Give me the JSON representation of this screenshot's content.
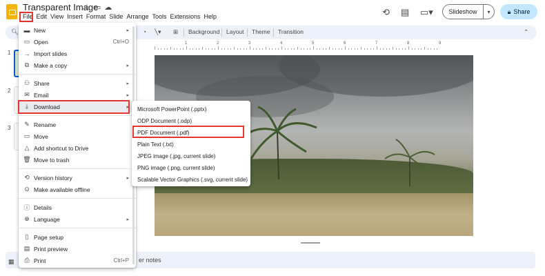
{
  "header": {
    "doc_title": "Transparent Image",
    "title_icons": [
      "star-icon",
      "folder-icon",
      "cloud-icon"
    ],
    "menus": [
      "File",
      "Edit",
      "View",
      "Insert",
      "Format",
      "Slide",
      "Arrange",
      "Tools",
      "Extensions",
      "Help"
    ],
    "slideshow_label": "Slideshow",
    "share_label": "Share"
  },
  "toolbar": {
    "background": "Background",
    "layout": "Layout",
    "theme": "Theme",
    "transition": "Transition"
  },
  "ruler": [
    "1",
    "2",
    "3",
    "4",
    "5",
    "6",
    "7",
    "8",
    "9"
  ],
  "filmstrip": [
    "1",
    "2",
    "3"
  ],
  "notes": "er notes",
  "file_menu": {
    "items": [
      {
        "label": "New",
        "icon": "new-presentation-icon",
        "arrow": true
      },
      {
        "label": "Open",
        "icon": "folder-open-icon",
        "shortcut": "Ctrl+O"
      },
      {
        "label": "Import slides",
        "icon": "import-icon"
      },
      {
        "label": "Make a copy",
        "icon": "copy-icon",
        "arrow": true
      },
      {
        "label": "Share",
        "icon": "person-add-icon",
        "arrow": true
      },
      {
        "label": "Email",
        "icon": "email-icon",
        "arrow": true
      },
      {
        "label": "Download",
        "icon": "download-icon",
        "arrow": true
      },
      {
        "label": "Rename",
        "icon": "rename-icon"
      },
      {
        "label": "Move",
        "icon": "move-icon"
      },
      {
        "label": "Add shortcut to Drive",
        "icon": "drive-shortcut-icon"
      },
      {
        "label": "Move to trash",
        "icon": "trash-icon"
      },
      {
        "label": "Version history",
        "icon": "history-icon",
        "arrow": true
      },
      {
        "label": "Make available offline",
        "icon": "offline-icon"
      },
      {
        "label": "Details",
        "icon": "info-icon"
      },
      {
        "label": "Language",
        "icon": "globe-icon",
        "arrow": true
      },
      {
        "label": "Page setup",
        "icon": "page-setup-icon"
      },
      {
        "label": "Print preview",
        "icon": "print-preview-icon"
      },
      {
        "label": "Print",
        "icon": "print-icon",
        "shortcut": "Ctrl+P"
      }
    ]
  },
  "download_submenu": [
    "Microsoft PowerPoint (.pptx)",
    "ODP Document (.odp)",
    "PDF Document (.pdf)",
    "Plain Text (.txt)",
    "JPEG image (.jpg, current slide)",
    "PNG image (.png, current slide)",
    "Scalable Vector Graphics (.svg, current slide)"
  ],
  "colors": {
    "highlight_red": "#e3342f",
    "share_bg": "#c2e7ff",
    "toolbar_bg": "#edf2fa",
    "logo_yellow": "#f6b400"
  }
}
